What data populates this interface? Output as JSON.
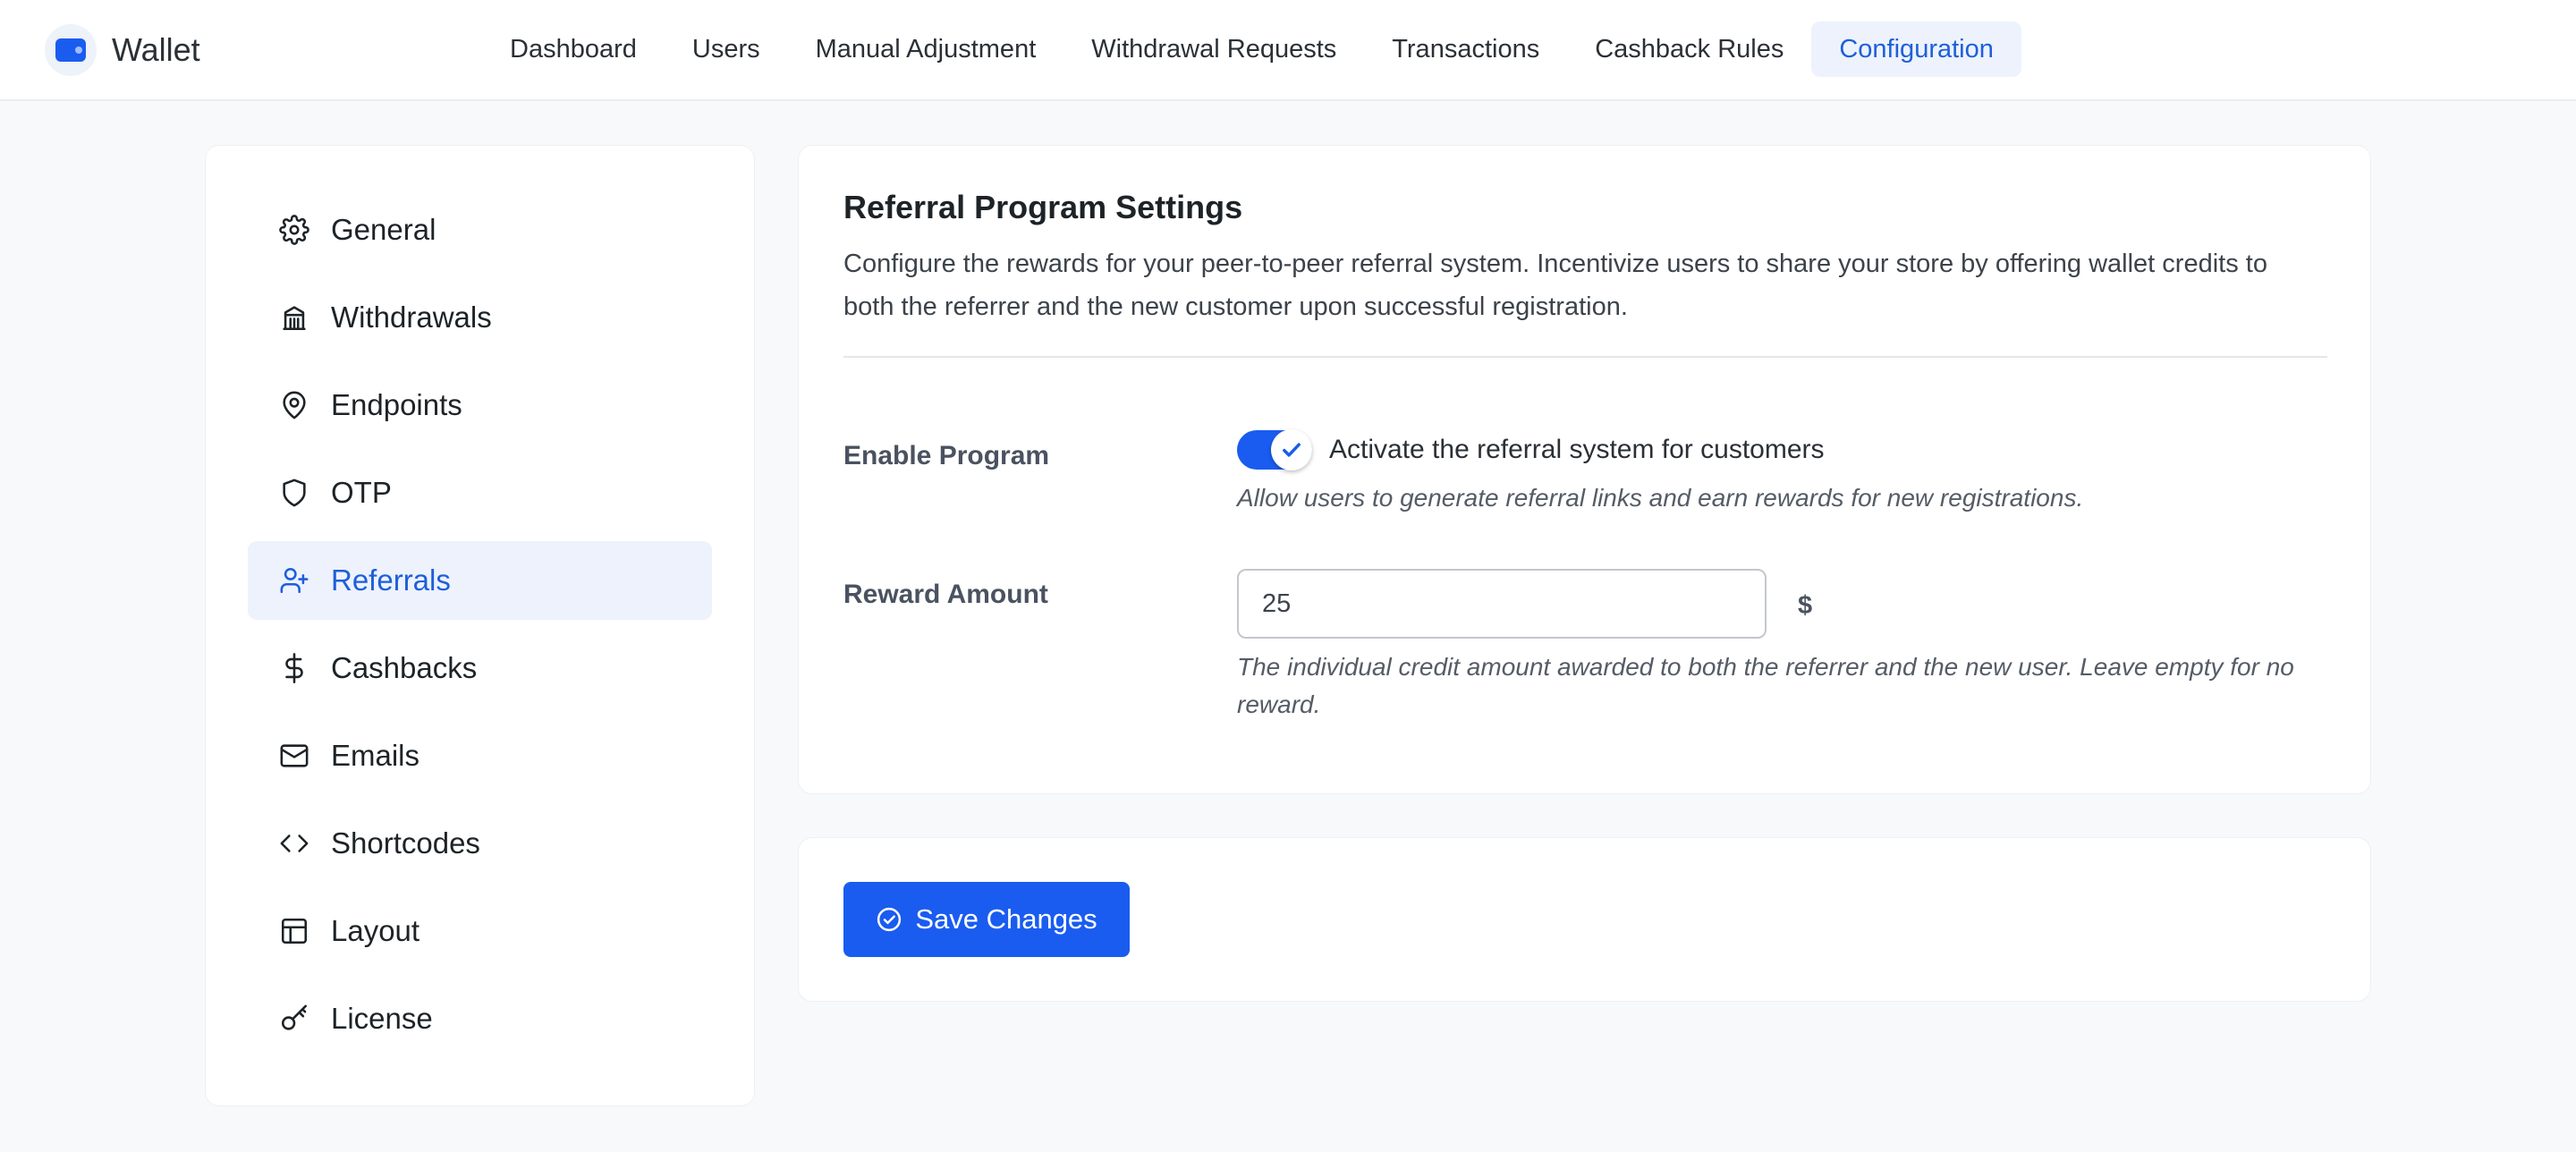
{
  "brand": {
    "name": "Wallet",
    "accent": "#1a5cf0"
  },
  "nav": {
    "items": [
      {
        "label": "Dashboard"
      },
      {
        "label": "Users"
      },
      {
        "label": "Manual Adjustment"
      },
      {
        "label": "Withdrawal Requests"
      },
      {
        "label": "Transactions"
      },
      {
        "label": "Cashback Rules"
      },
      {
        "label": "Configuration",
        "active": true
      }
    ]
  },
  "sidebar": {
    "items": [
      {
        "label": "General",
        "icon": "gear-icon"
      },
      {
        "label": "Withdrawals",
        "icon": "bank-icon"
      },
      {
        "label": "Endpoints",
        "icon": "map-pin-icon"
      },
      {
        "label": "OTP",
        "icon": "shield-icon"
      },
      {
        "label": "Referrals",
        "icon": "user-plus-icon",
        "active": true
      },
      {
        "label": "Cashbacks",
        "icon": "dollar-icon"
      },
      {
        "label": "Emails",
        "icon": "mail-icon"
      },
      {
        "label": "Shortcodes",
        "icon": "code-icon"
      },
      {
        "label": "Layout",
        "icon": "layout-icon"
      },
      {
        "label": "License",
        "icon": "key-icon"
      }
    ]
  },
  "settings": {
    "title": "Referral Program Settings",
    "description": "Configure the rewards for your peer-to-peer referral system. Incentivize users to share your store by offering wallet credits to both the referrer and the new customer upon successful registration.",
    "enable": {
      "label": "Enable Program",
      "checked": true,
      "toggle_text": "Activate the referral system for customers",
      "help": "Allow users to generate referral links and earn rewards for new registrations."
    },
    "reward": {
      "label": "Reward Amount",
      "value": "25",
      "currency": "$",
      "help": "The individual credit amount awarded to both the referrer and the new user. Leave empty for no reward."
    }
  },
  "actions": {
    "save_label": "Save Changes",
    "save_icon": "check-circle-icon"
  }
}
